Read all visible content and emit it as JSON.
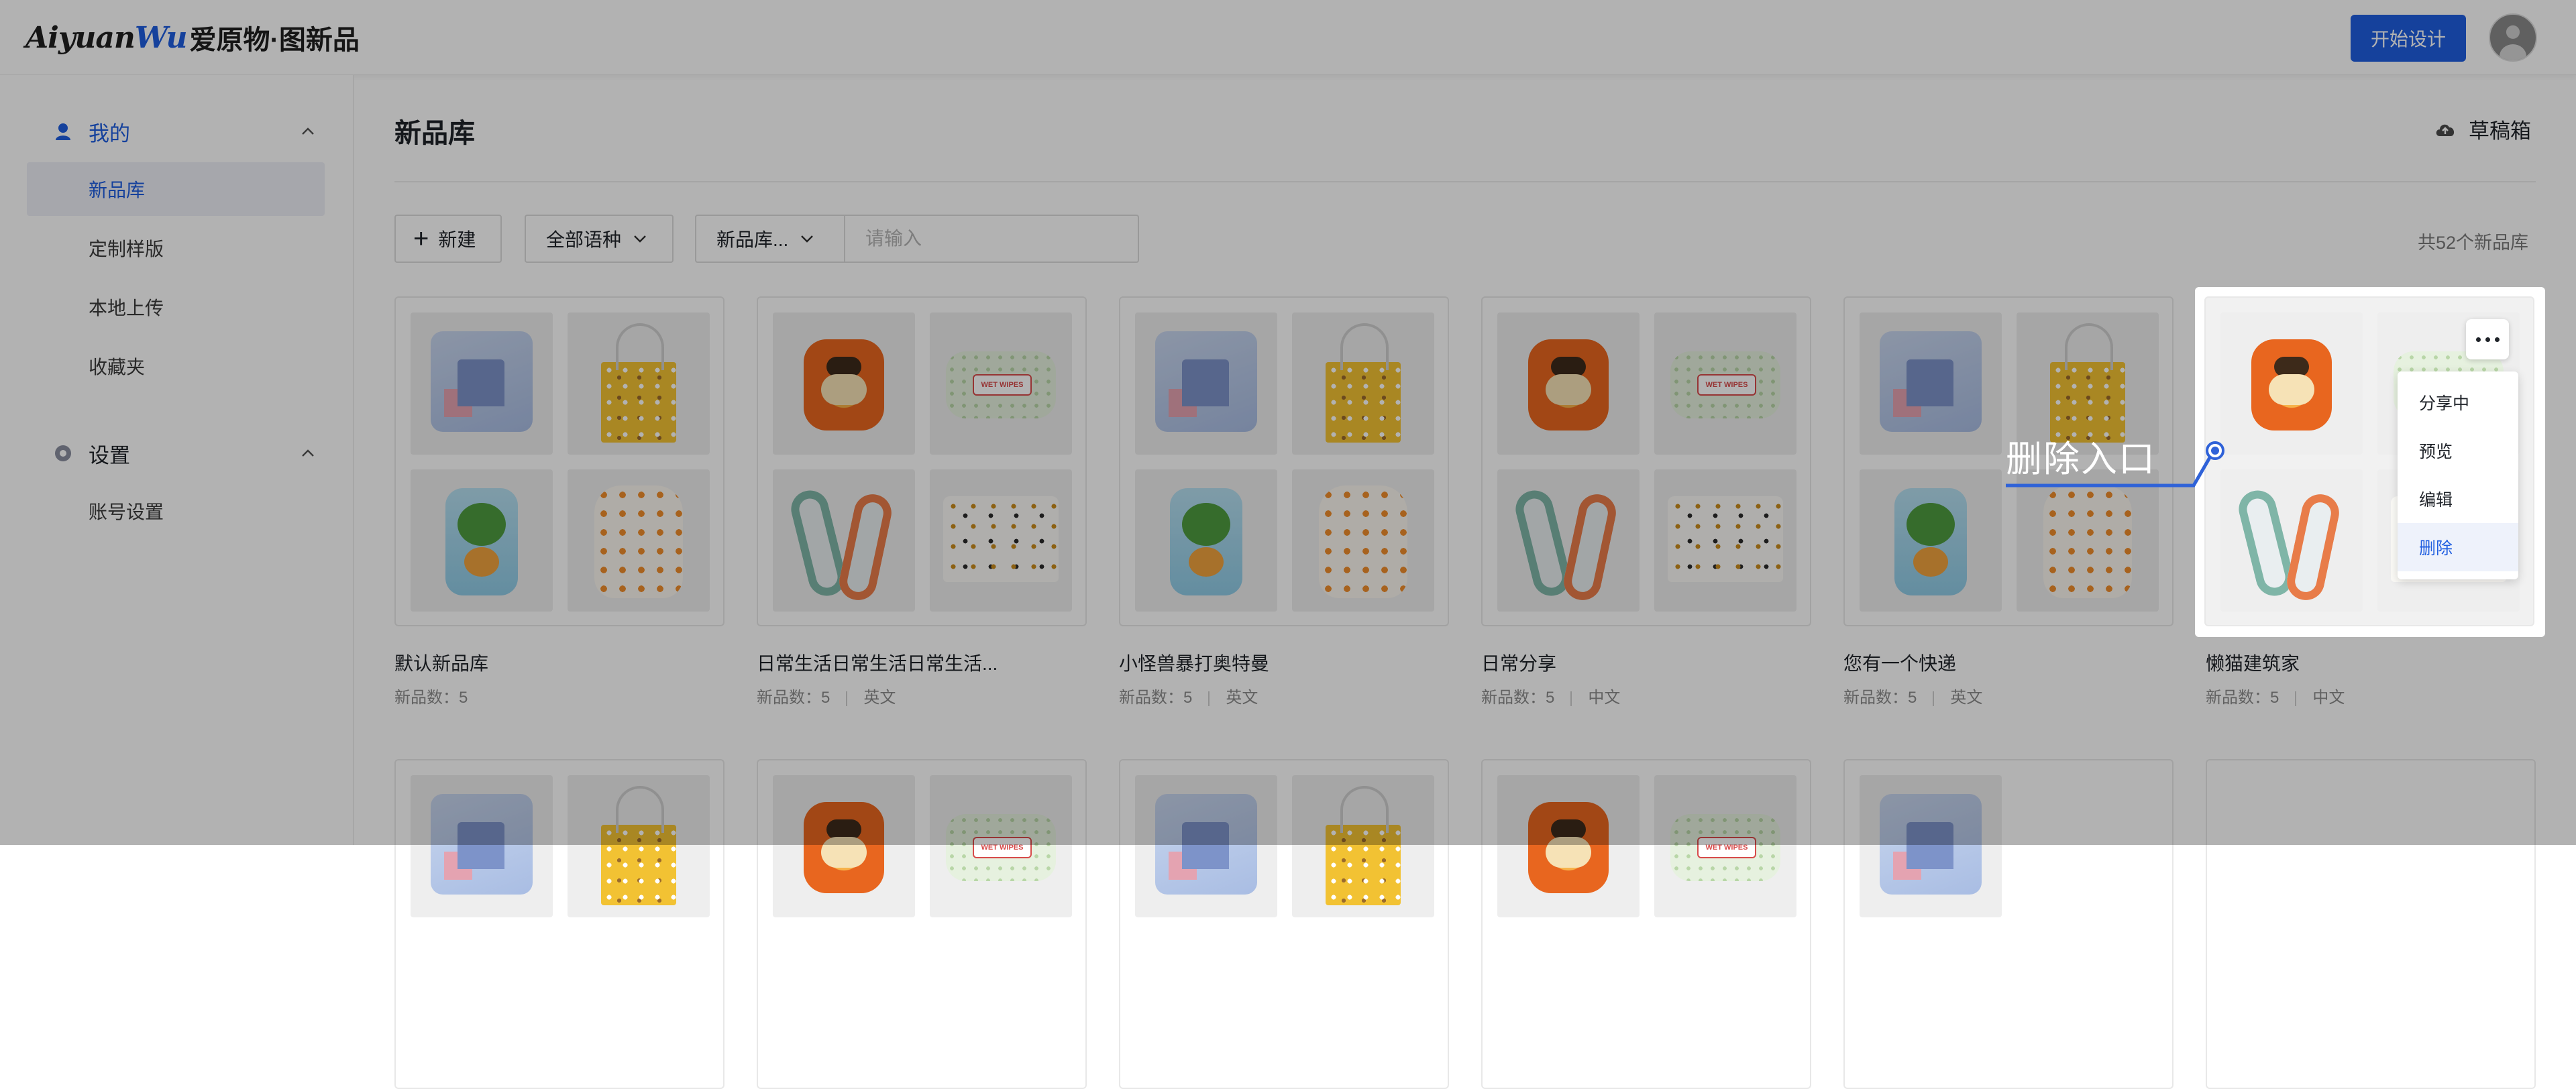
{
  "header": {
    "logo_script": "Aiyuan",
    "logo_script_accent": "Wu",
    "logo_cn": "爱原物·图新品",
    "start_button": "开始设计"
  },
  "sidebar": {
    "groups": [
      {
        "label": "我的",
        "icon": "user-icon",
        "items": [
          "新品库",
          "定制样版",
          "本地上传",
          "收藏夹"
        ]
      },
      {
        "label": "设置",
        "icon": "settings-icon",
        "items": [
          "账号设置"
        ]
      }
    ],
    "active_item": "新品库"
  },
  "main": {
    "title": "新品库",
    "draft_label": "草稿箱",
    "new_button": "新建",
    "language_filter": "全部语种",
    "scope_select": "新品库...",
    "search_placeholder": "请输入",
    "count_text": "共52个新品库"
  },
  "cards": [
    {
      "name": "默认新品库",
      "count": "新品数：5",
      "lang": ""
    },
    {
      "name": "日常生活日常生活日常生活...",
      "count": "新品数：5",
      "lang": "英文"
    },
    {
      "name": "小怪兽暴打奥特曼",
      "count": "新品数：5",
      "lang": "英文"
    },
    {
      "name": "日常分享",
      "count": "新品数：5",
      "lang": "中文"
    },
    {
      "name": "您有一个快递",
      "count": "新品数：5",
      "lang": "英文"
    },
    {
      "name": "懒猫建筑家",
      "count": "新品数：5",
      "lang": "中文"
    }
  ],
  "context_menu": {
    "items": [
      "分享中",
      "预览",
      "编辑",
      "删除"
    ],
    "active": "删除"
  },
  "annotation": {
    "label": "删除入口"
  },
  "colors": {
    "accent": "#1f5ee0",
    "overlay": "rgba(0,0,0,0.30)"
  }
}
